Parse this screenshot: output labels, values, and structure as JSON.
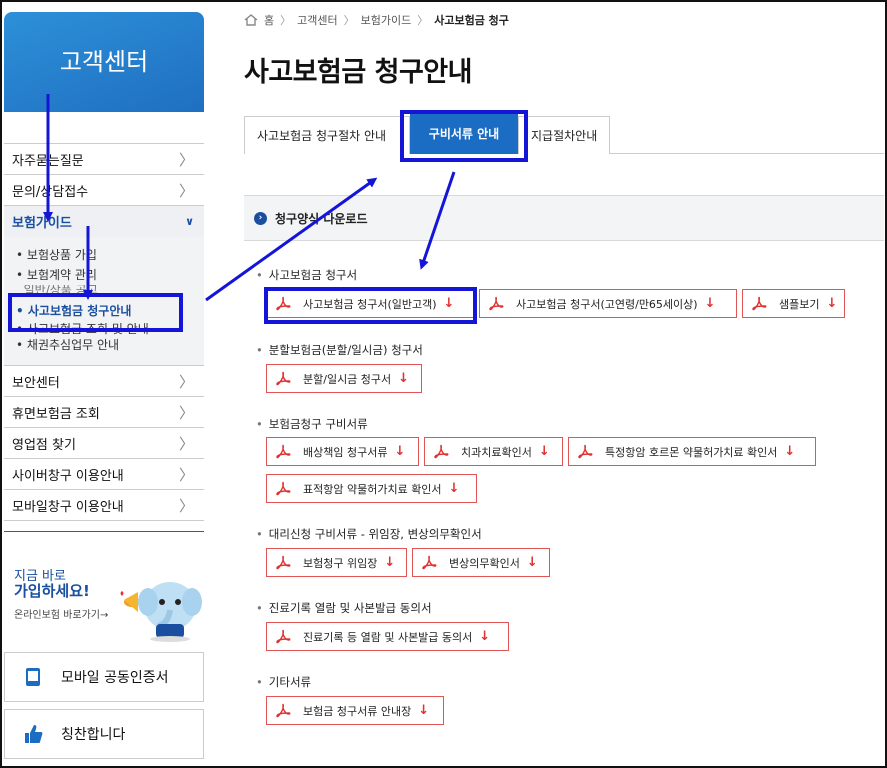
{
  "sidebar": {
    "title": "고객센터",
    "menu": [
      {
        "label": "자주묻는질문"
      },
      {
        "label": "문의/상담접수"
      }
    ],
    "open_menu": {
      "label": "보험가이드"
    },
    "submenu": [
      {
        "label": "보험상품 가입"
      },
      {
        "label": "보험계약 관리"
      },
      {
        "label": "일반/상품 공고"
      },
      {
        "label": "사고보험금 청구안내"
      },
      {
        "label": "사고보험금 조회 및 안내"
      },
      {
        "label": "채권추심업무 안내"
      }
    ],
    "menu_bottom": [
      {
        "label": "보안센터"
      },
      {
        "label": "휴면보험금 조회"
      },
      {
        "label": "영업점 찾기"
      },
      {
        "label": "사이버창구 이용안내"
      },
      {
        "label": "모바일창구 이용안내"
      }
    ],
    "promo": {
      "line1": "지금 바로",
      "line2": "가입하세요!",
      "link": "온라인보험 바로가기→"
    },
    "mobile_cert": "모바일 공동인증서",
    "praise": "칭찬합니다"
  },
  "breadcrumb": [
    "홈",
    "고객센터",
    "보험가이드",
    "사고보험금 청구"
  ],
  "page_title": "사고보험금 청구안내",
  "tabs": [
    {
      "label": "사고보험금 청구절차 안내"
    },
    {
      "label": "구비서류 안내"
    },
    {
      "label": "지급절차안내"
    }
  ],
  "download_bar": "청구양식 다운로드",
  "sections": [
    {
      "title": "사고보험금 청구서",
      "files": [
        "사고보험금 청구서(일반고객)",
        "사고보험금 청구서(고연령/만65세이상)",
        "샘플보기"
      ]
    },
    {
      "title": "분할보험금(분할/일시금) 청구서",
      "files": [
        "분할/일시금 청구서"
      ]
    },
    {
      "title": "보험금청구 구비서류",
      "files": [
        "배상책임 청구서류",
        "치과치료확인서",
        "특정항암 호르몬 약물허가치료 확인서",
        "표적항암 약물허가치료 확인서"
      ]
    },
    {
      "title": "대리신청 구비서류 - 위임장, 변상의무확인서",
      "files": [
        "보험청구 위임장",
        "변상의무확인서"
      ]
    },
    {
      "title": "진료기록 열람 및 사본발급 동의서",
      "files": [
        "진료기록 등 열람 및 사본발급 동의서"
      ]
    },
    {
      "title": "기타서류",
      "files": [
        "보험금 청구서류 안내장"
      ]
    }
  ],
  "colors": {
    "accent": "#1b6dc4",
    "annotation": "#1515d8",
    "pdf_red": "#e03030"
  }
}
